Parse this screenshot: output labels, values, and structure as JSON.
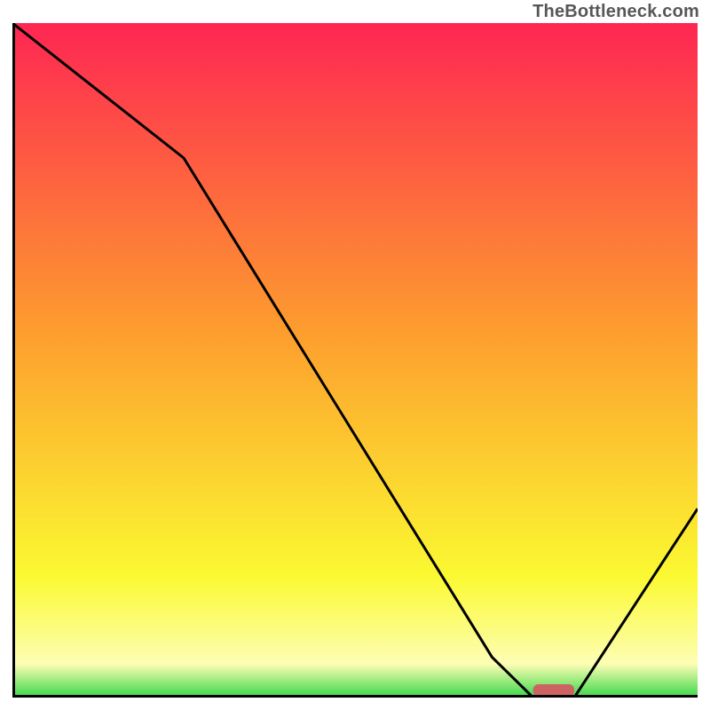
{
  "watermark": "TheBottleneck.com",
  "chart_data": {
    "type": "line",
    "title": "",
    "xlabel": "",
    "ylabel": "",
    "xlim": [
      0,
      100
    ],
    "ylim": [
      0,
      100
    ],
    "grid": false,
    "series": [
      {
        "name": "bottleneck-curve",
        "x": [
          0,
          25,
          70,
          76,
          82,
          100
        ],
        "values": [
          100,
          80,
          6,
          0,
          0,
          28
        ]
      }
    ],
    "marker": {
      "name": "optimal-range",
      "x_start": 76,
      "x_end": 82,
      "y": 0,
      "color": "#ce6263"
    },
    "gradient": {
      "top_color": "#fe2652",
      "upper_mid_color": "#fd9e2e",
      "lower_mid_color": "#fbf931",
      "low_color": "#fdfeb4",
      "bottom_color": "#3ad749"
    }
  }
}
